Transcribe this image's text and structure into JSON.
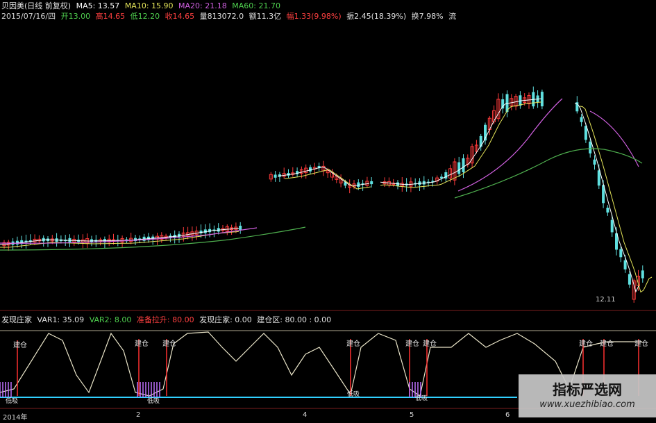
{
  "header": {
    "title": "贝因美(日线 前复权)",
    "ma5": "MA5: 13.57",
    "ma10": "MA10: 15.90",
    "ma20": "MA20: 21.18",
    "ma60": "MA60: 21.70",
    "date": "2015/07/16/四",
    "open": "开13.00",
    "high": "高14.65",
    "low": "低12.20",
    "close": "收14.65",
    "volume": "量813072.0",
    "amount": "额11.3亿",
    "change": "幅1.33(9.98%)",
    "amplitude": "振2.45(18.39%)",
    "turnover": "换7.98%",
    "trailing": "流"
  },
  "indicator": {
    "name": "发现庄家",
    "var1": "VAR1: 35.09",
    "var2": "VAR2: 8.00",
    "zhuli": "准备拉升: 80.00",
    "faxian": "发现庄家: 0.00",
    "jiancang": "建仓区: 80.00 : 0.00",
    "signal_label": "建仓",
    "low_label": "低吸"
  },
  "price_low_label": "12.11",
  "x_axis": {
    "labels": [
      "2014年",
      "2",
      "4",
      "5",
      "6"
    ]
  },
  "watermark": {
    "cn": "指标严选网",
    "url": "www.xuezhibiao.com"
  },
  "colors": {
    "up": "#ff3b3b",
    "down": "#5fe0e0",
    "ma5": "#ffffff",
    "ma10": "#e6e65a",
    "ma20": "#d060e0",
    "ma60": "#4fb04f",
    "osc": "#e9e4c8",
    "signal": "#ff3030",
    "purple": "#c070ff",
    "cyan": "#30d0ff"
  },
  "chart_data": [
    {
      "type": "candlestick",
      "title": "贝因美(日线 前复权)",
      "series": [
        {
          "name": "MA5",
          "values": [
            13.57
          ]
        },
        {
          "name": "MA10",
          "values": [
            15.9
          ]
        },
        {
          "name": "MA20",
          "values": [
            21.18
          ]
        },
        {
          "name": "MA60",
          "values": [
            21.7
          ]
        }
      ],
      "last_bar": {
        "date": "2015/07/16",
        "open": 13.0,
        "high": 14.65,
        "low": 12.2,
        "close": 14.65
      },
      "annotation": "12.11"
    },
    {
      "type": "line",
      "title": "发现庄家",
      "series": [
        {
          "name": "VAR1",
          "values": [
            35.09
          ]
        },
        {
          "name": "VAR2",
          "values": [
            8.0
          ]
        },
        {
          "name": "准备拉升",
          "values": [
            80.0
          ]
        },
        {
          "name": "发现庄家",
          "values": [
            0.0
          ]
        },
        {
          "name": "建仓区",
          "values": [
            80.0,
            0.0
          ]
        }
      ]
    }
  ]
}
